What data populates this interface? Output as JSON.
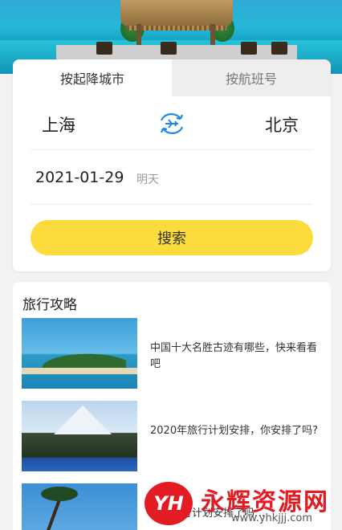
{
  "tabs": [
    {
      "label": "按起降城市",
      "active": true
    },
    {
      "label": "按航班号",
      "active": false
    }
  ],
  "route": {
    "from_city": "上海",
    "to_city": "北京",
    "swap_icon": "plane-swap-icon"
  },
  "date": {
    "value": "2021-01-29",
    "sub": "明天"
  },
  "search": {
    "label": "搜索"
  },
  "guide": {
    "title": "旅行攻略",
    "articles": [
      {
        "title": "中国十大名胜古迹有哪些，快来看看吧"
      },
      {
        "title": "2020年旅行计划安排，你安排了吗?"
      },
      {
        "title": "你的旅行计划安排了吗…"
      }
    ]
  },
  "watermark": {
    "logo": "YH",
    "text": "永辉资源网",
    "url": "www.yhkjjj.com"
  },
  "colors": {
    "accent": "#fbdc3c",
    "swap_icon": "#1e88e5",
    "watermark": "#e31b23"
  }
}
